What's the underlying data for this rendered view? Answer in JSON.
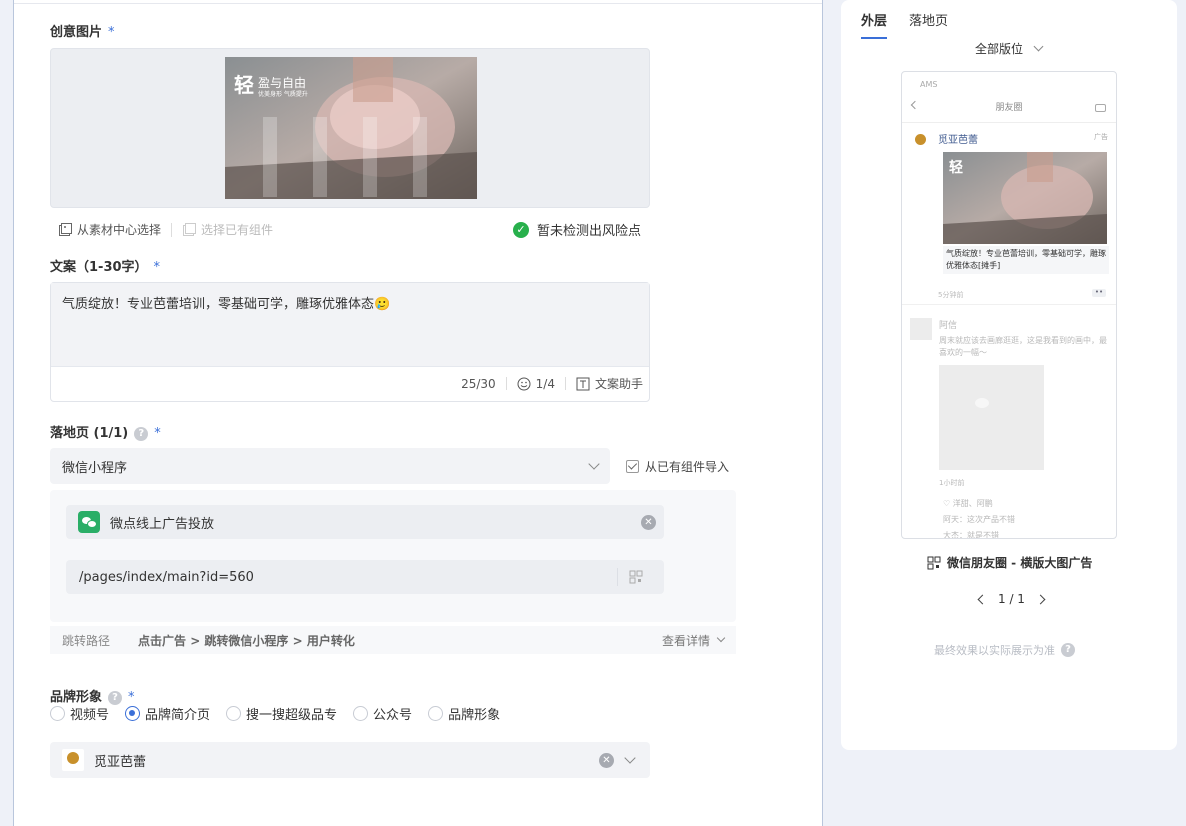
{
  "form": {
    "creative_image": {
      "label": "创意图片",
      "required_mark": "*"
    },
    "image_text": {
      "title_big": "轻",
      "title_small": "盈与自由",
      "subtitle": "优美身形 气质提升"
    },
    "image_tools": {
      "from_library": "从素材中心选择",
      "from_component": "选择已有组件",
      "risk_status": "暂未检测出风险点"
    },
    "copy": {
      "label": "文案（1-30字）",
      "required_mark": "*",
      "value": "气质绽放！专业芭蕾培训，零基础可学，雕琢优雅体态🥲",
      "count": "25/30",
      "emoji_count": "1/4",
      "assistant": "文案助手"
    },
    "landing": {
      "label": "落地页 (1/1)",
      "help": "?",
      "required_mark": "*",
      "type_value": "微信小程序",
      "import_label": "从已有组件导入",
      "mini_program_name": "微点线上广告投放",
      "path_value": "/pages/index/main?id=560",
      "jump_label": "跳转路径",
      "jump_value": "点击广告 > 跳转微信小程序 > 用户转化",
      "details": "查看详情"
    },
    "brand": {
      "label": "品牌形象",
      "help": "?",
      "required_mark": "*",
      "options": [
        "视频号",
        "品牌简介页",
        "搜一搜超级品专",
        "公众号",
        "品牌形象"
      ],
      "selected": "品牌简介页",
      "value": "觅亚芭蕾"
    }
  },
  "preview": {
    "tabs": [
      "外层",
      "落地页"
    ],
    "active_tab": "外层",
    "position": "全部版位",
    "phone": {
      "status": "AMS",
      "nav_title": "朋友圈",
      "account": "觅亚芭蕾",
      "ad_tag": "广告",
      "caption": "气质绽放！专业芭蕾培训，零基础可学，雕琢优雅体态[摊手]",
      "time": "5分钟前",
      "friend_name": "阿信",
      "friend_text": "周末就应该去画廊逛逛，这是我看到的画中，最喜欢的一幅～",
      "friend_time": "1小时前",
      "likes": "♡ 洋甜、阿鹏",
      "comment1": "阿天：这次产品不错",
      "comment2": "大杰：就是不错",
      "dots": "••"
    },
    "format": "微信朋友圈 - 横版大图广告",
    "pager": "1 / 1",
    "note": "最终效果以实际展示为准"
  },
  "colors": {
    "accent": "#3a6fd8",
    "success": "#28b04c",
    "wechat": "#2aae67"
  },
  "icons": [
    "library-icon",
    "component-icon",
    "check-circle-icon",
    "emoji-icon",
    "text-icon",
    "chevron-down-icon",
    "checkbox-icon",
    "wechat-icon",
    "clear-icon",
    "qrcode-icon",
    "help-icon",
    "radio-icon",
    "chevron-left-icon",
    "chevron-right-icon"
  ]
}
